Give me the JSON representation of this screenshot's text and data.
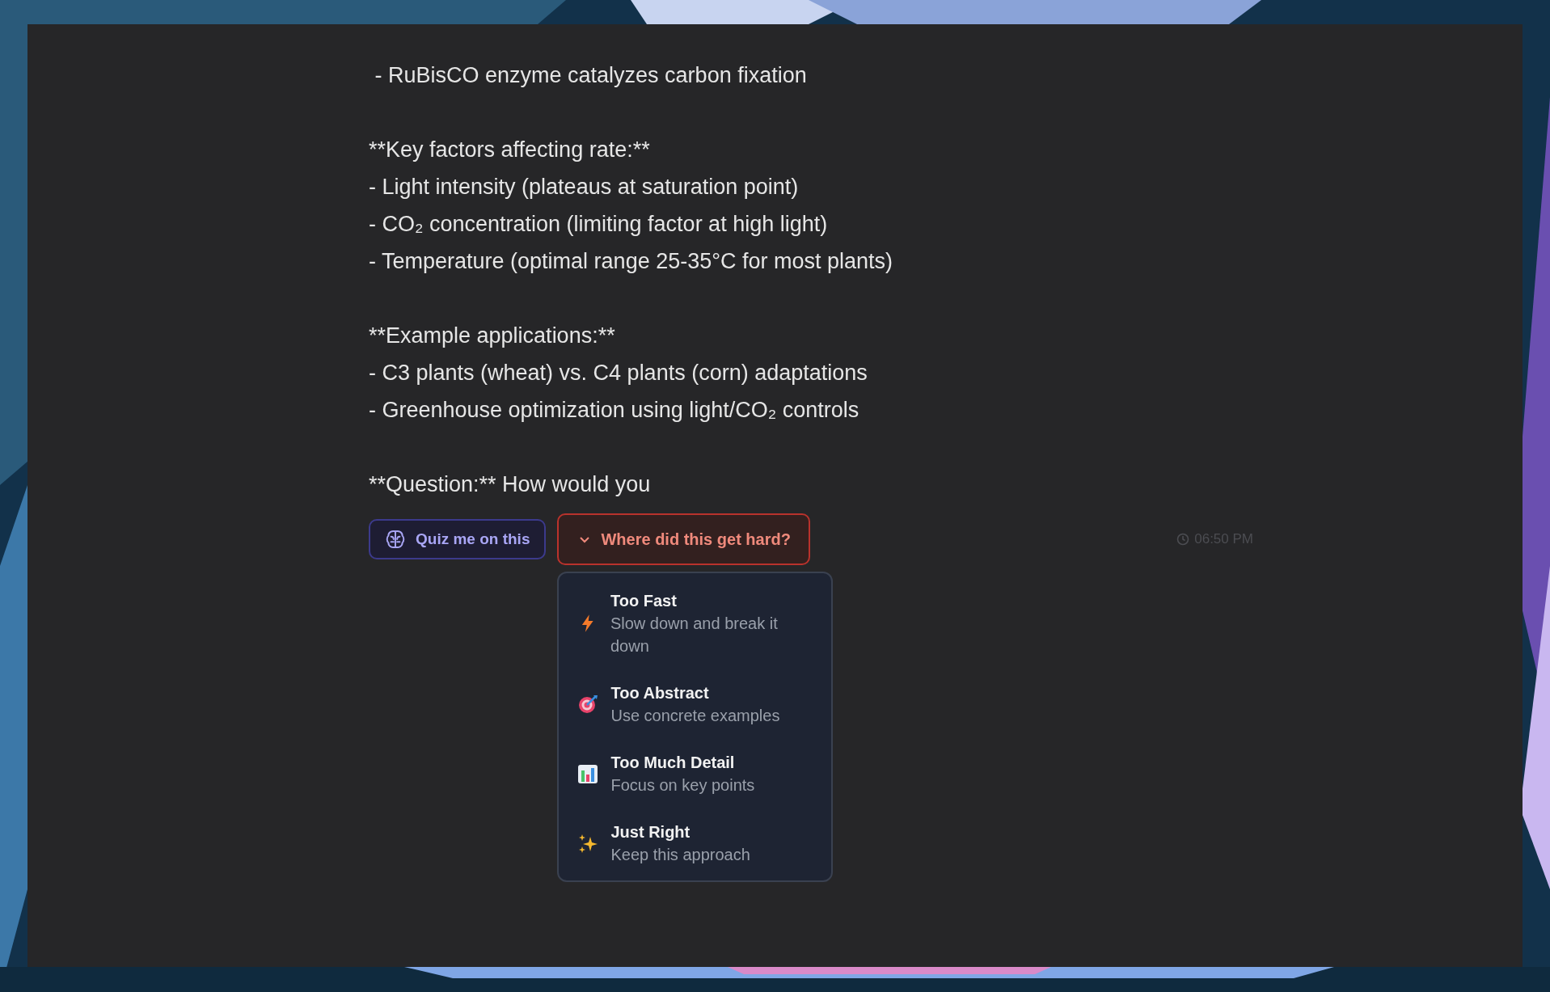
{
  "message": {
    "lines": [
      {
        "kind": "text",
        "text": " - RuBisCO enzyme catalyzes carbon fixation"
      },
      {
        "kind": "blank"
      },
      {
        "kind": "text",
        "text": "**Key factors affecting rate:**"
      },
      {
        "kind": "text",
        "text": "- Light intensity (plateaus at saturation point)"
      },
      {
        "kind": "text",
        "text": "- CO₂ concentration (limiting factor at high light)"
      },
      {
        "kind": "text",
        "text": "- Temperature (optimal range 25-35°C for most plants)"
      },
      {
        "kind": "blank"
      },
      {
        "kind": "text",
        "text": "**Example applications:**"
      },
      {
        "kind": "text",
        "text": "- C3 plants (wheat) vs. C4 plants (corn) adaptations"
      },
      {
        "kind": "text",
        "text": "- Greenhouse optimization using light/CO₂ controls"
      },
      {
        "kind": "blank"
      },
      {
        "kind": "text",
        "text": "**Question:** How would you"
      }
    ]
  },
  "quiz_button": {
    "label": "Quiz me on this"
  },
  "difficulty_button": {
    "label": "Where did this get hard?",
    "expanded": true
  },
  "timestamp": "06:50 PM",
  "difficulty_menu": [
    {
      "kind": "bolt",
      "title": "Too Fast",
      "subtitle": "Slow down and break it down"
    },
    {
      "kind": "target",
      "title": "Too Abstract",
      "subtitle": "Use concrete examples"
    },
    {
      "kind": "chart",
      "title": "Too Much Detail",
      "subtitle": "Focus on key points"
    },
    {
      "kind": "sparkles",
      "title": "Just Right",
      "subtitle": "Keep this approach"
    }
  ]
}
